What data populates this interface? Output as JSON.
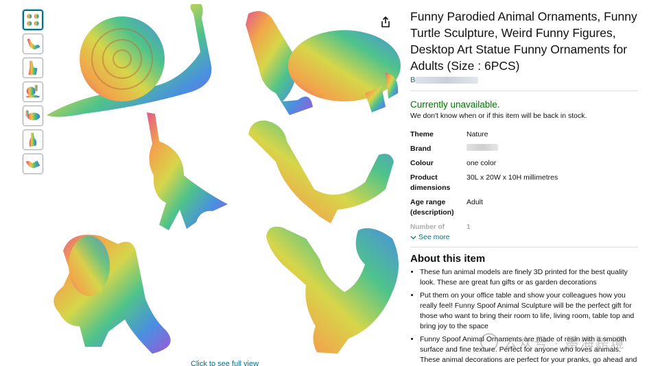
{
  "product": {
    "title": "Funny Parodied Animal Ornaments, Funny Turtle Sculpture, Weird Funny Figures, Desktop Art Statue Funny Ornaments for Adults (Size : 6PCS)",
    "brand_link_initial": "B"
  },
  "availability": {
    "status": "Currently unavailable.",
    "note": "We don't know when or if this item will be back in stock."
  },
  "specs": [
    {
      "key": "Theme",
      "value": "Nature"
    },
    {
      "key": "Brand",
      "value": ""
    },
    {
      "key": "Colour",
      "value": "one color"
    },
    {
      "key": "Product dimensions",
      "value": "30L x 20W x 10H millimetres"
    },
    {
      "key": "Age range (description)",
      "value": "Adult"
    }
  ],
  "specs_fade": {
    "key": "Number of",
    "value": "1"
  },
  "see_more": "See more",
  "about": {
    "title": "About this item",
    "bullets": [
      "These fun animal models are finely 3D printed for the best quality look. These are great fun gifts or as garden decorations",
      "Put them on your office table and show your colleagues how you really feel! Funny Spoof Animal Sculpture will be the perfect gift for those who want to bring their room to life, living room, table top and bring joy to the space",
      "Funny Spoof Animal Ornaments are made of resin with a smooth surface and fine texture. Perfect for anyone who loves animals. These animal decorations are perfect for your pranks, go ahead and make your family and friends laugh"
    ]
  },
  "image": {
    "see_full_view": "Click to see full view",
    "thumbnail_count": 7
  },
  "watermark": "公众号 · 墨海跨境",
  "colors": {
    "link": "#007185",
    "available_green": "#007600",
    "text": "#0f1111",
    "divider": "#dddddd"
  },
  "icons": [
    "share-icon",
    "chevron-down-icon"
  ]
}
